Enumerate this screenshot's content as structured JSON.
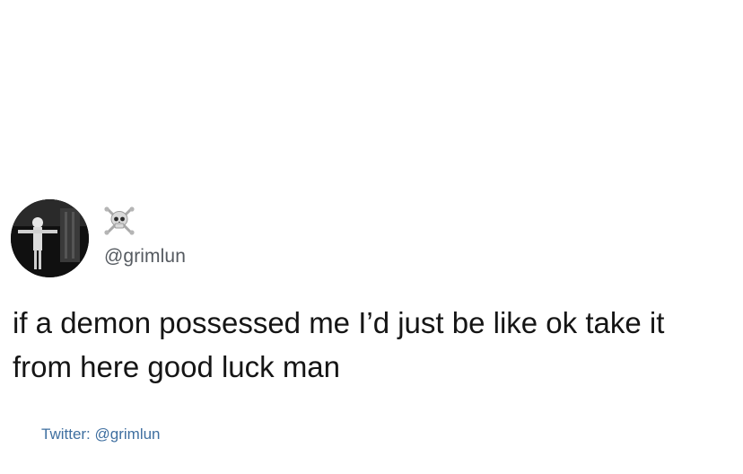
{
  "tweet": {
    "display_name_icon": "skull-and-crossbones-icon",
    "handle": "@grimlun",
    "text": "if a demon possessed me I’d just be like ok take it from here good luck man",
    "source": "Twitter: @grimlun"
  },
  "colors": {
    "background": "#ffffff",
    "text": "#151515",
    "handle": "#555a60",
    "source_link": "#3f6fa0"
  }
}
